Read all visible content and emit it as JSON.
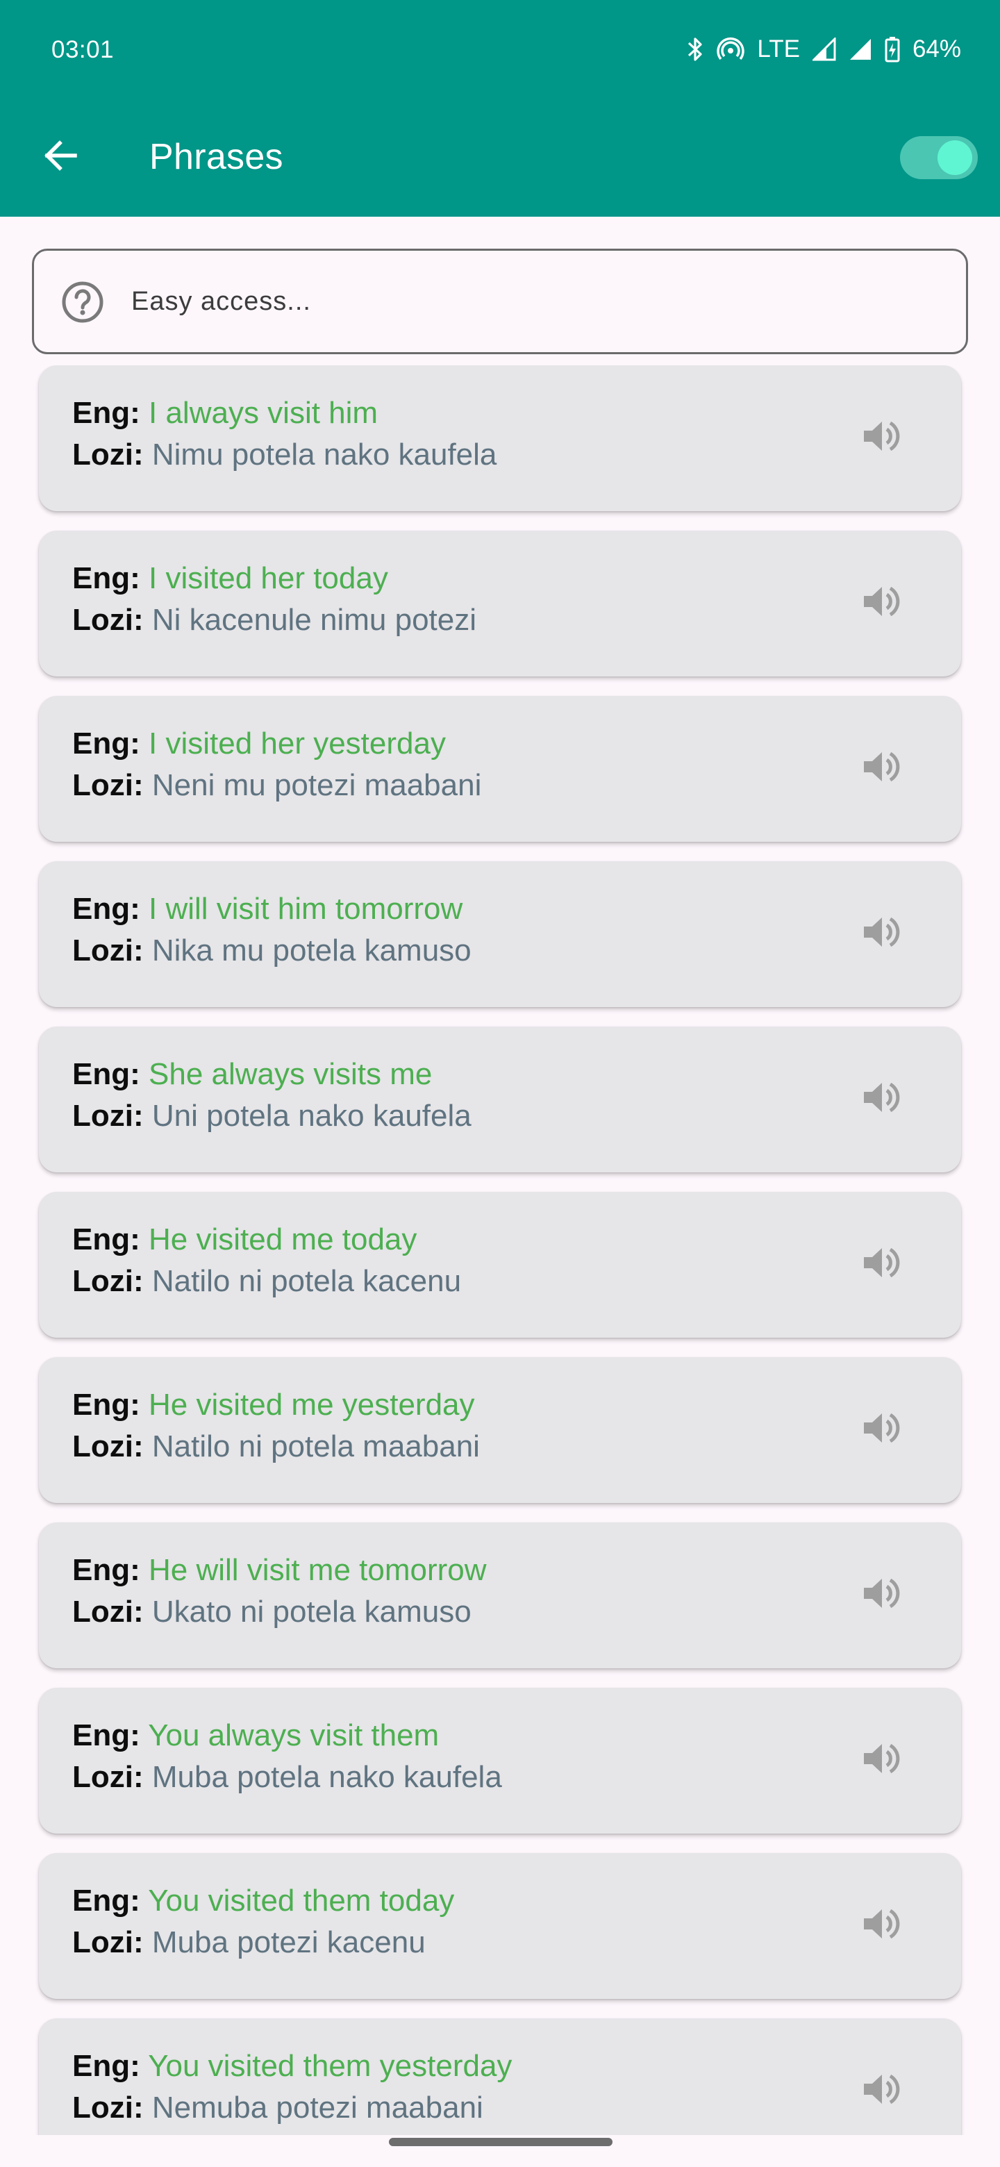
{
  "status_bar": {
    "time": "03:01",
    "network": "LTE",
    "battery": "64%",
    "icons": [
      "bluetooth-icon",
      "hotspot-icon",
      "signal-icon",
      "signal-icon",
      "battery-charging-icon"
    ]
  },
  "app_bar": {
    "title": "Phrases",
    "back_icon": "arrow-left-icon",
    "toggle_on": true
  },
  "search": {
    "placeholder": "Easy access...",
    "icon": "help-circle-icon"
  },
  "labels": {
    "eng": "Eng:",
    "lozi": "Lozi:"
  },
  "phrases": [
    {
      "eng": "I always visit him",
      "lozi": "Nimu potela nako kaufela"
    },
    {
      "eng": "I visited her today",
      "lozi": "Ni kacenule nimu potezi"
    },
    {
      "eng": "I visited her yesterday",
      "lozi": "Neni mu potezi maabani"
    },
    {
      "eng": "I will visit him tomorrow",
      "lozi": "Nika mu potela kamuso"
    },
    {
      "eng": "She always visits me",
      "lozi": "Uni potela nako kaufela"
    },
    {
      "eng": "He visited me today",
      "lozi": "Natilo ni potela kacenu"
    },
    {
      "eng": "He visited me yesterday",
      "lozi": "Natilo ni potela maabani"
    },
    {
      "eng": "He will visit me tomorrow",
      "lozi": "Ukato ni potela kamuso"
    },
    {
      "eng": "You always visit them",
      "lozi": "Muba potela nako kaufela"
    },
    {
      "eng": "You visited them today",
      "lozi": "Muba potezi kacenu"
    },
    {
      "eng": "You visited them yesterday",
      "lozi": "Nemuba potezi maabani"
    }
  ],
  "colors": {
    "primary": "#009688",
    "english_text": "#4caf50",
    "lozi_text": "#5f7380",
    "card_background": "#e6e5e8",
    "speaker_icon": "#9e9e9e"
  }
}
